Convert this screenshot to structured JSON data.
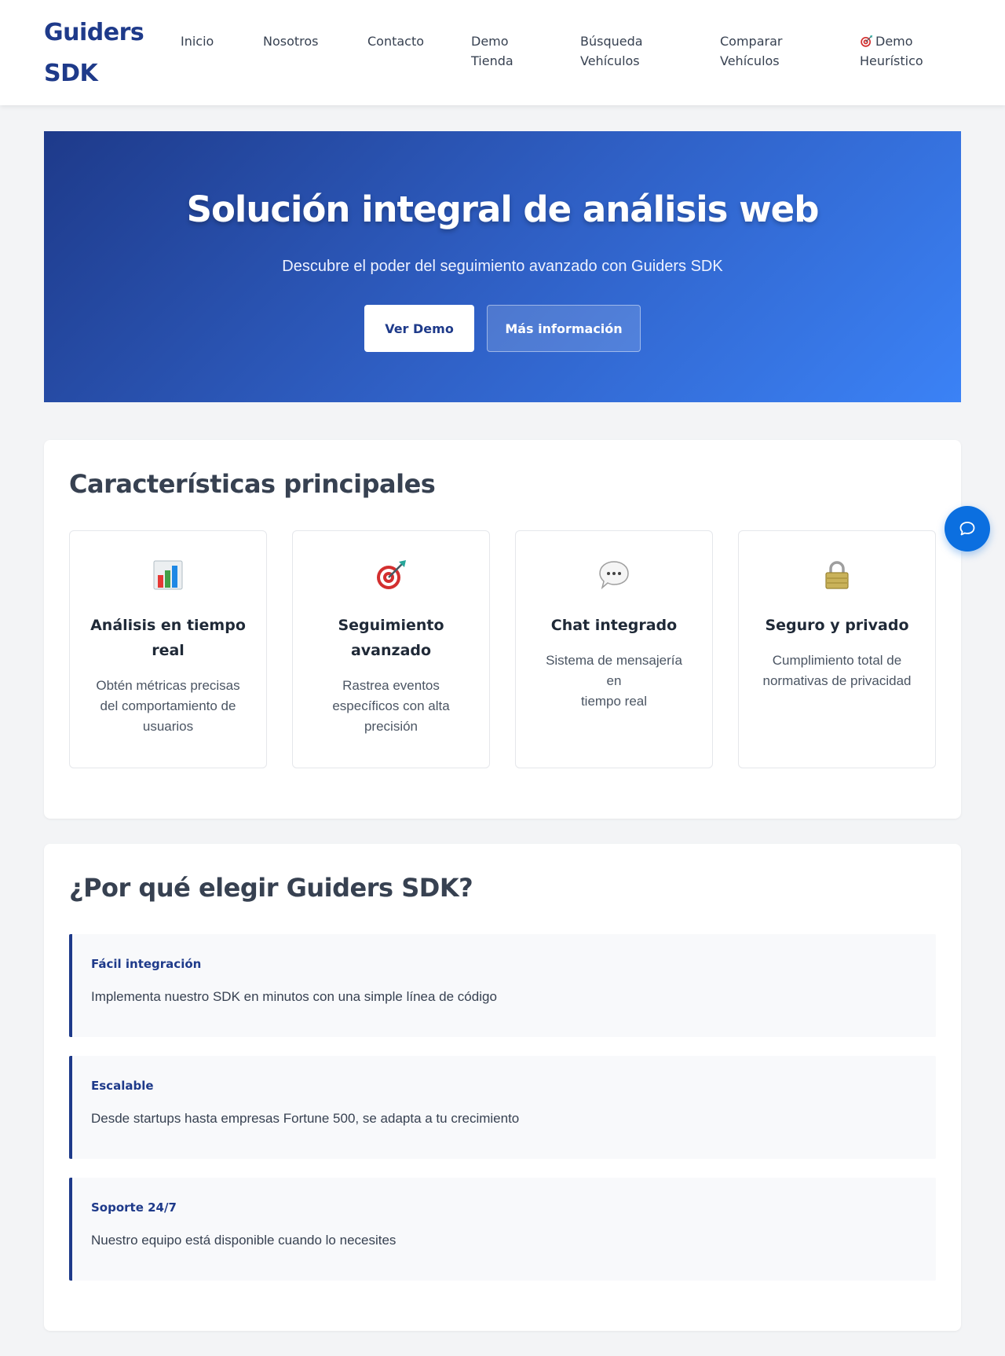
{
  "header": {
    "brand_line1": "Guiders",
    "brand_line2": "SDK",
    "nav": [
      {
        "line1": "Inicio",
        "line2": ""
      },
      {
        "line1": "Nosotros",
        "line2": ""
      },
      {
        "line1": "Contacto",
        "line2": ""
      },
      {
        "line1": "Demo",
        "line2": "Tienda"
      },
      {
        "line1": "Búsqueda",
        "line2": "Vehículos"
      },
      {
        "line1": "Comparar",
        "line2": "Vehículos"
      },
      {
        "line1": "Demo",
        "line2": "Heurístico",
        "icon": "target-icon"
      }
    ]
  },
  "hero": {
    "title": "Solución integral de análisis web",
    "subtitle": "Descubre el poder del seguimiento avanzado con Guiders SDK",
    "primary_button": "Ver Demo",
    "secondary_button": "Más información"
  },
  "features": {
    "title": "Características principales",
    "items": [
      {
        "icon": "bar-chart-icon",
        "title_line1": "Análisis en tiempo",
        "title_line2": "real",
        "desc_line1": "Obtén métricas precisas",
        "desc_line2": "del comportamiento de",
        "desc_line3": "usuarios"
      },
      {
        "icon": "target-icon",
        "title_line1": "Seguimiento",
        "title_line2": "avanzado",
        "desc_line1": "Rastrea eventos",
        "desc_line2": "específicos con alta",
        "desc_line3": "precisión"
      },
      {
        "icon": "speech-bubble-icon",
        "title_line1": "Chat integrado",
        "title_line2": "",
        "desc_line1": "Sistema de mensajería en",
        "desc_line2": "tiempo real",
        "desc_line3": ""
      },
      {
        "icon": "lock-icon",
        "title_line1": "Seguro y privado",
        "title_line2": "",
        "desc_line1": "Cumplimiento total de",
        "desc_line2": "normativas de privacidad",
        "desc_line3": ""
      }
    ]
  },
  "why": {
    "title": "¿Por qué elegir Guiders SDK?",
    "items": [
      {
        "title": "Fácil integración",
        "text": "Implementa nuestro SDK en minutos con una simple línea de código"
      },
      {
        "title": "Escalable",
        "text": "Desde startups hasta empresas Fortune 500, se adapta a tu crecimiento"
      },
      {
        "title": "Soporte 24/7",
        "text": "Nuestro equipo está disponible cuando lo necesites"
      }
    ]
  },
  "colors": {
    "brand": "#1e3a8a",
    "accent": "#3b82f6",
    "chat_button": "#0b6fe0"
  }
}
